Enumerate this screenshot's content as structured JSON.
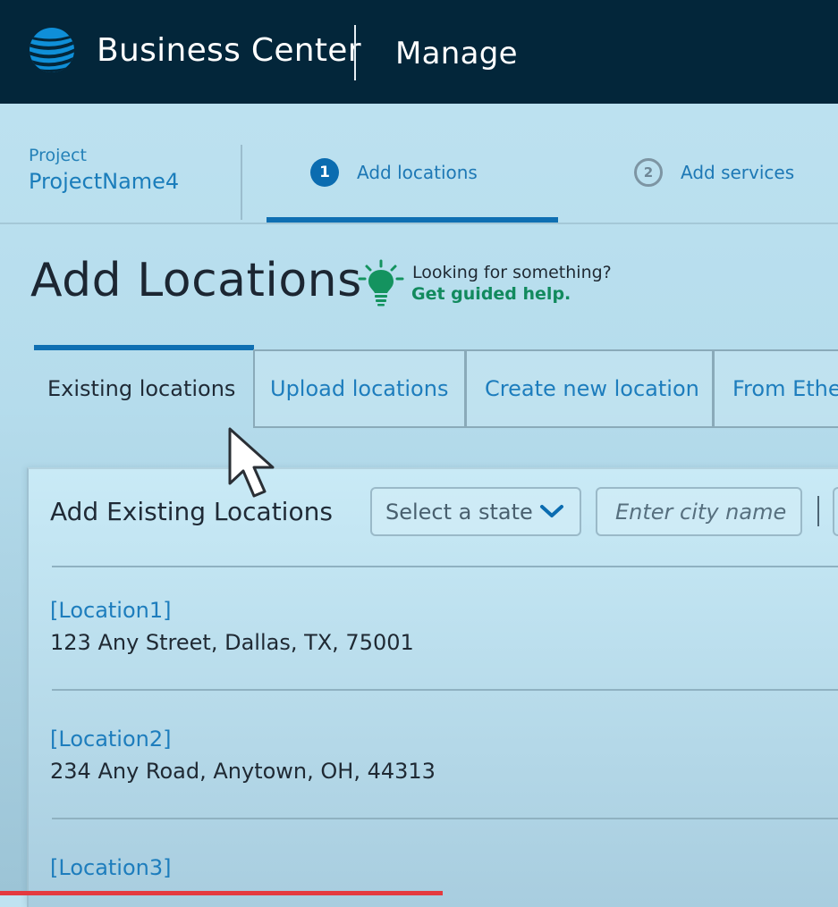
{
  "header": {
    "brand": "Business Center",
    "section": "Manage",
    "logo_icon": "att-globe-icon",
    "colors": {
      "background": "#03263a",
      "logo": "#0f8fd8"
    }
  },
  "progress": {
    "project_label": "Project",
    "project_name": "ProjectName4",
    "steps": [
      {
        "number": "1",
        "label": "Add locations",
        "state": "active"
      },
      {
        "number": "2",
        "label": "Add services",
        "state": "inactive"
      }
    ]
  },
  "page": {
    "title": "Add Locations",
    "help_icon": "lightbulb-icon",
    "help_text": "Looking for something?",
    "help_link": "Get guided help."
  },
  "tabs": [
    {
      "label": "Existing locations",
      "active": true
    },
    {
      "label": "Upload locations",
      "active": false
    },
    {
      "label": "Create new location",
      "active": false
    },
    {
      "label": "From Ethe",
      "active": false
    }
  ],
  "panel": {
    "title": "Add Existing Locations",
    "state_select": {
      "value": "Select a state",
      "icon": "chevron-down-icon"
    },
    "city_input": {
      "placeholder": "Enter city name",
      "value": ""
    },
    "locations": [
      {
        "name": "[Location1]",
        "address": "123 Any Street, Dallas, TX, 75001"
      },
      {
        "name": "[Location2]",
        "address": "234 Any Road, Anytown, OH, 44313"
      },
      {
        "name": "[Location3]",
        "address": ""
      }
    ]
  },
  "colors": {
    "accent": "#0f6fb2",
    "link": "#1d7dbd",
    "help_link": "#128a5e",
    "bottom_progress": "#e43a3f"
  }
}
